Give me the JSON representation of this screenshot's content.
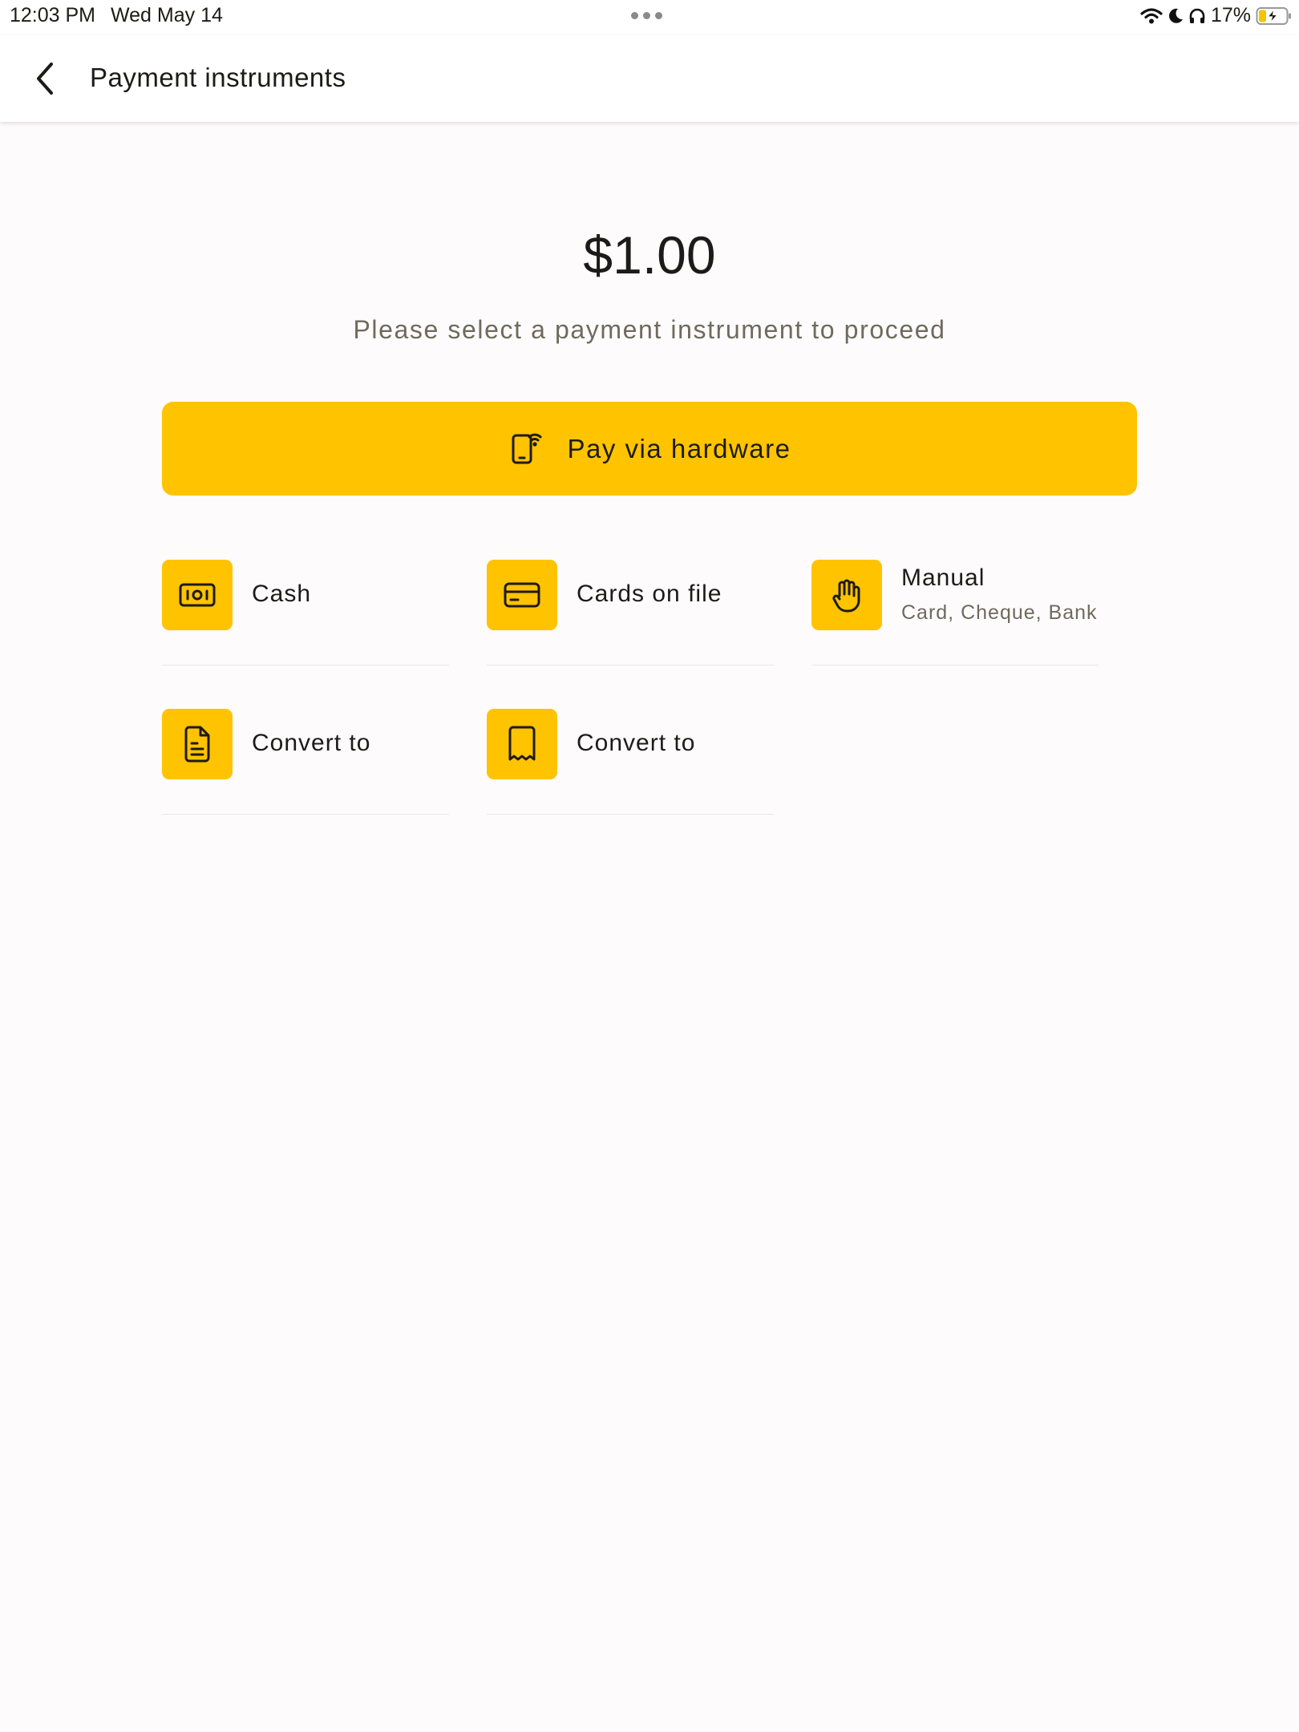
{
  "status_bar": {
    "time": "12:03 PM",
    "date": "Wed May 14",
    "battery": "17%",
    "icons": [
      "wifi-icon",
      "moon-icon",
      "headphones-icon",
      "battery-charging-icon"
    ]
  },
  "header": {
    "back_icon": "chevron-left-icon",
    "title": "Payment instruments"
  },
  "payment": {
    "amount": "$1.00",
    "prompt": "Please select a payment instrument to proceed"
  },
  "primary_action": {
    "icon": "phone-contactless-icon",
    "label": "Pay via hardware"
  },
  "options": [
    {
      "label": "Cash",
      "icon": "cash-icon"
    },
    {
      "label": "Cards on file",
      "icon": "credit-card-icon"
    },
    {
      "label": "Manual",
      "sublabel": "Card, Cheque, Bank",
      "icon": "hand-icon"
    },
    {
      "label": "Convert to",
      "icon": "document-icon"
    },
    {
      "label": "Convert to",
      "icon": "receipt-icon"
    }
  ],
  "colors": {
    "accent": "#ffc300",
    "background": "#fefbfd",
    "text": "#1d1b19",
    "muted_text": "#6f6a5c",
    "divider": "#ece8ea"
  }
}
